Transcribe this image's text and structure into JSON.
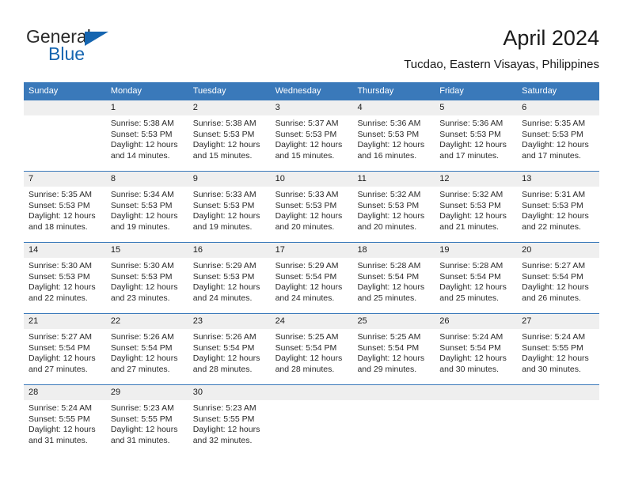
{
  "brand": {
    "name_part1": "General",
    "name_part2": "Blue",
    "flag_icon": "blue-triangle-flag-icon",
    "accent_color": "#1565b0"
  },
  "header": {
    "title": "April 2024",
    "subtitle": "Tucdao, Eastern Visayas, Philippines"
  },
  "theme": {
    "header_blue": "#3a79ba",
    "day_band_gray": "#efefef",
    "text_color": "#1a1a1a"
  },
  "weekdays": [
    "Sunday",
    "Monday",
    "Tuesday",
    "Wednesday",
    "Thursday",
    "Friday",
    "Saturday"
  ],
  "weeks": [
    [
      {
        "day": "",
        "sunrise": "",
        "sunset": "",
        "daylight_line1": "",
        "daylight_line2": ""
      },
      {
        "day": "1",
        "sunrise": "Sunrise: 5:38 AM",
        "sunset": "Sunset: 5:53 PM",
        "daylight_line1": "Daylight: 12 hours",
        "daylight_line2": "and 14 minutes."
      },
      {
        "day": "2",
        "sunrise": "Sunrise: 5:38 AM",
        "sunset": "Sunset: 5:53 PM",
        "daylight_line1": "Daylight: 12 hours",
        "daylight_line2": "and 15 minutes."
      },
      {
        "day": "3",
        "sunrise": "Sunrise: 5:37 AM",
        "sunset": "Sunset: 5:53 PM",
        "daylight_line1": "Daylight: 12 hours",
        "daylight_line2": "and 15 minutes."
      },
      {
        "day": "4",
        "sunrise": "Sunrise: 5:36 AM",
        "sunset": "Sunset: 5:53 PM",
        "daylight_line1": "Daylight: 12 hours",
        "daylight_line2": "and 16 minutes."
      },
      {
        "day": "5",
        "sunrise": "Sunrise: 5:36 AM",
        "sunset": "Sunset: 5:53 PM",
        "daylight_line1": "Daylight: 12 hours",
        "daylight_line2": "and 17 minutes."
      },
      {
        "day": "6",
        "sunrise": "Sunrise: 5:35 AM",
        "sunset": "Sunset: 5:53 PM",
        "daylight_line1": "Daylight: 12 hours",
        "daylight_line2": "and 17 minutes."
      }
    ],
    [
      {
        "day": "7",
        "sunrise": "Sunrise: 5:35 AM",
        "sunset": "Sunset: 5:53 PM",
        "daylight_line1": "Daylight: 12 hours",
        "daylight_line2": "and 18 minutes."
      },
      {
        "day": "8",
        "sunrise": "Sunrise: 5:34 AM",
        "sunset": "Sunset: 5:53 PM",
        "daylight_line1": "Daylight: 12 hours",
        "daylight_line2": "and 19 minutes."
      },
      {
        "day": "9",
        "sunrise": "Sunrise: 5:33 AM",
        "sunset": "Sunset: 5:53 PM",
        "daylight_line1": "Daylight: 12 hours",
        "daylight_line2": "and 19 minutes."
      },
      {
        "day": "10",
        "sunrise": "Sunrise: 5:33 AM",
        "sunset": "Sunset: 5:53 PM",
        "daylight_line1": "Daylight: 12 hours",
        "daylight_line2": "and 20 minutes."
      },
      {
        "day": "11",
        "sunrise": "Sunrise: 5:32 AM",
        "sunset": "Sunset: 5:53 PM",
        "daylight_line1": "Daylight: 12 hours",
        "daylight_line2": "and 20 minutes."
      },
      {
        "day": "12",
        "sunrise": "Sunrise: 5:32 AM",
        "sunset": "Sunset: 5:53 PM",
        "daylight_line1": "Daylight: 12 hours",
        "daylight_line2": "and 21 minutes."
      },
      {
        "day": "13",
        "sunrise": "Sunrise: 5:31 AM",
        "sunset": "Sunset: 5:53 PM",
        "daylight_line1": "Daylight: 12 hours",
        "daylight_line2": "and 22 minutes."
      }
    ],
    [
      {
        "day": "14",
        "sunrise": "Sunrise: 5:30 AM",
        "sunset": "Sunset: 5:53 PM",
        "daylight_line1": "Daylight: 12 hours",
        "daylight_line2": "and 22 minutes."
      },
      {
        "day": "15",
        "sunrise": "Sunrise: 5:30 AM",
        "sunset": "Sunset: 5:53 PM",
        "daylight_line1": "Daylight: 12 hours",
        "daylight_line2": "and 23 minutes."
      },
      {
        "day": "16",
        "sunrise": "Sunrise: 5:29 AM",
        "sunset": "Sunset: 5:53 PM",
        "daylight_line1": "Daylight: 12 hours",
        "daylight_line2": "and 24 minutes."
      },
      {
        "day": "17",
        "sunrise": "Sunrise: 5:29 AM",
        "sunset": "Sunset: 5:54 PM",
        "daylight_line1": "Daylight: 12 hours",
        "daylight_line2": "and 24 minutes."
      },
      {
        "day": "18",
        "sunrise": "Sunrise: 5:28 AM",
        "sunset": "Sunset: 5:54 PM",
        "daylight_line1": "Daylight: 12 hours",
        "daylight_line2": "and 25 minutes."
      },
      {
        "day": "19",
        "sunrise": "Sunrise: 5:28 AM",
        "sunset": "Sunset: 5:54 PM",
        "daylight_line1": "Daylight: 12 hours",
        "daylight_line2": "and 25 minutes."
      },
      {
        "day": "20",
        "sunrise": "Sunrise: 5:27 AM",
        "sunset": "Sunset: 5:54 PM",
        "daylight_line1": "Daylight: 12 hours",
        "daylight_line2": "and 26 minutes."
      }
    ],
    [
      {
        "day": "21",
        "sunrise": "Sunrise: 5:27 AM",
        "sunset": "Sunset: 5:54 PM",
        "daylight_line1": "Daylight: 12 hours",
        "daylight_line2": "and 27 minutes."
      },
      {
        "day": "22",
        "sunrise": "Sunrise: 5:26 AM",
        "sunset": "Sunset: 5:54 PM",
        "daylight_line1": "Daylight: 12 hours",
        "daylight_line2": "and 27 minutes."
      },
      {
        "day": "23",
        "sunrise": "Sunrise: 5:26 AM",
        "sunset": "Sunset: 5:54 PM",
        "daylight_line1": "Daylight: 12 hours",
        "daylight_line2": "and 28 minutes."
      },
      {
        "day": "24",
        "sunrise": "Sunrise: 5:25 AM",
        "sunset": "Sunset: 5:54 PM",
        "daylight_line1": "Daylight: 12 hours",
        "daylight_line2": "and 28 minutes."
      },
      {
        "day": "25",
        "sunrise": "Sunrise: 5:25 AM",
        "sunset": "Sunset: 5:54 PM",
        "daylight_line1": "Daylight: 12 hours",
        "daylight_line2": "and 29 minutes."
      },
      {
        "day": "26",
        "sunrise": "Sunrise: 5:24 AM",
        "sunset": "Sunset: 5:54 PM",
        "daylight_line1": "Daylight: 12 hours",
        "daylight_line2": "and 30 minutes."
      },
      {
        "day": "27",
        "sunrise": "Sunrise: 5:24 AM",
        "sunset": "Sunset: 5:55 PM",
        "daylight_line1": "Daylight: 12 hours",
        "daylight_line2": "and 30 minutes."
      }
    ],
    [
      {
        "day": "28",
        "sunrise": "Sunrise: 5:24 AM",
        "sunset": "Sunset: 5:55 PM",
        "daylight_line1": "Daylight: 12 hours",
        "daylight_line2": "and 31 minutes."
      },
      {
        "day": "29",
        "sunrise": "Sunrise: 5:23 AM",
        "sunset": "Sunset: 5:55 PM",
        "daylight_line1": "Daylight: 12 hours",
        "daylight_line2": "and 31 minutes."
      },
      {
        "day": "30",
        "sunrise": "Sunrise: 5:23 AM",
        "sunset": "Sunset: 5:55 PM",
        "daylight_line1": "Daylight: 12 hours",
        "daylight_line2": "and 32 minutes."
      },
      {
        "day": "",
        "sunrise": "",
        "sunset": "",
        "daylight_line1": "",
        "daylight_line2": ""
      },
      {
        "day": "",
        "sunrise": "",
        "sunset": "",
        "daylight_line1": "",
        "daylight_line2": ""
      },
      {
        "day": "",
        "sunrise": "",
        "sunset": "",
        "daylight_line1": "",
        "daylight_line2": ""
      },
      {
        "day": "",
        "sunrise": "",
        "sunset": "",
        "daylight_line1": "",
        "daylight_line2": ""
      }
    ]
  ]
}
